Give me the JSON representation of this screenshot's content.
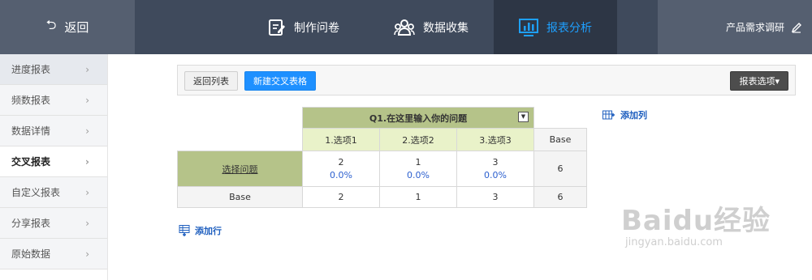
{
  "top": {
    "back_label": "返回",
    "nav": [
      {
        "label": "制作问卷",
        "icon": "edit-survey-icon"
      },
      {
        "label": "数据收集",
        "icon": "users-icon"
      },
      {
        "label": "报表分析",
        "icon": "bar-chart-icon"
      }
    ],
    "project_title": "产品需求调研"
  },
  "sidebar": {
    "items": [
      {
        "label": "进度报表"
      },
      {
        "label": "频数报表"
      },
      {
        "label": "数据详情"
      },
      {
        "label": "交叉报表",
        "active": true
      },
      {
        "label": "自定义报表"
      },
      {
        "label": "分享报表"
      },
      {
        "label": "原始数据"
      }
    ]
  },
  "toolbar": {
    "back_list": "返回列表",
    "new_cross": "新建交叉表格",
    "options": "报表选项"
  },
  "table": {
    "question": "Q1.在这里输入你的问题",
    "options": [
      "1.选项1",
      "2.选项2",
      "3.选项3"
    ],
    "base_label": "Base",
    "row_label": "选择问题",
    "counts": [
      "2",
      "1",
      "3"
    ],
    "percents": [
      "0.0%",
      "0.0%",
      "0.0%"
    ],
    "row_base": "6",
    "base_row_label": "Base",
    "base_values": [
      "2",
      "1",
      "3",
      "6"
    ]
  },
  "actions": {
    "add_column": "添加列",
    "add_row": "添加行"
  },
  "watermark": {
    "main": "Baidu经验",
    "sub": "jingyan.baidu.com"
  },
  "colors": {
    "topbar": "#3f4a5c",
    "active_nav_text": "#1ea0ff",
    "primary_button": "#1e90ff",
    "question_header": "#b5c389",
    "option_header": "#e9f2c9",
    "percent_text": "#2b5fcf"
  }
}
